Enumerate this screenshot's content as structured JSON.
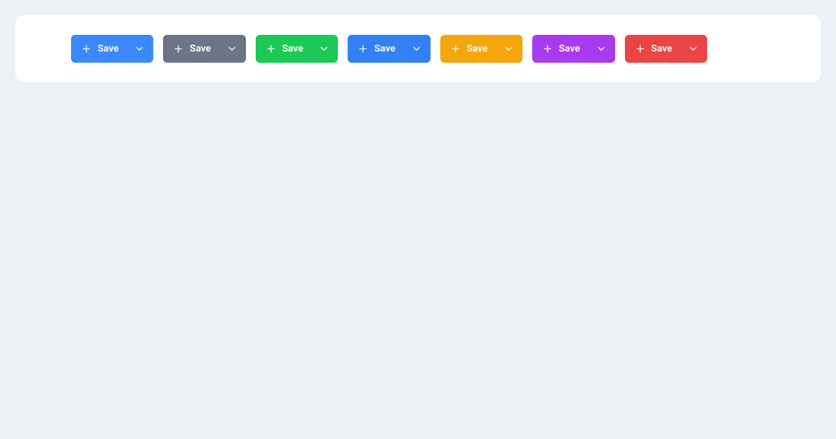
{
  "buttons": [
    {
      "label": "Save",
      "color": "#3b88fd"
    },
    {
      "label": "Save",
      "color": "#6b7587"
    },
    {
      "label": "Save",
      "color": "#1cc957"
    },
    {
      "label": "Save",
      "color": "#3180f6"
    },
    {
      "label": "Save",
      "color": "#f5a60c"
    },
    {
      "label": "Save",
      "color": "#a83af0"
    },
    {
      "label": "Save",
      "color": "#ea4444"
    }
  ]
}
